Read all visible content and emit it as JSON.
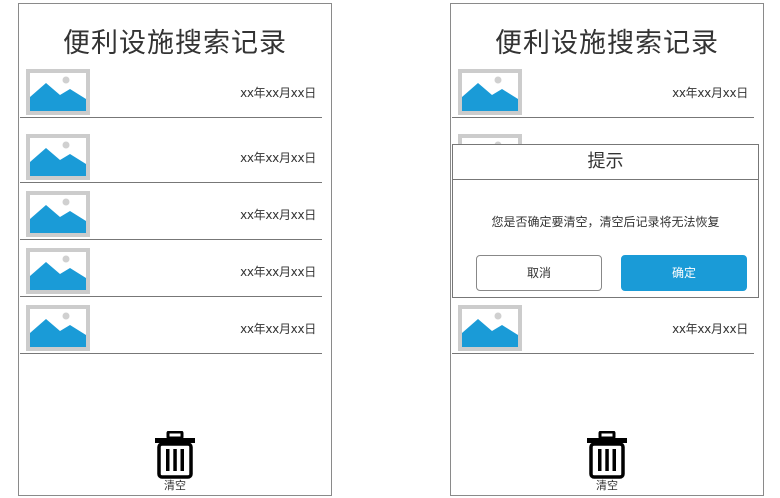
{
  "colors": {
    "accent": "#1a9bd7",
    "border": "#777777",
    "thumb_border": "#cccccc",
    "image_sky": "#d0d0d0"
  },
  "left_screen": {
    "title": "便利设施搜索记录",
    "records": [
      {
        "date": "xx年xx月xx日",
        "icon": "image-placeholder-icon"
      },
      {
        "date": "xx年xx月xx日",
        "icon": "image-placeholder-icon"
      },
      {
        "date": "xx年xx月xx日",
        "icon": "image-placeholder-icon"
      },
      {
        "date": "xx年xx月xx日",
        "icon": "image-placeholder-icon"
      },
      {
        "date": "xx年xx月xx日",
        "icon": "image-placeholder-icon"
      }
    ],
    "clear_label": "清空",
    "clear_icon": "trash-icon"
  },
  "right_screen": {
    "title": "便利设施搜索记录",
    "records": [
      {
        "date": "xx年xx月xx日",
        "icon": "image-placeholder-icon"
      },
      {
        "date": "xx年xx月xx日",
        "icon": "image-placeholder-icon"
      }
    ],
    "clear_label": "清空",
    "clear_icon": "trash-icon"
  },
  "dialog": {
    "title": "提示",
    "message": "您是否确定要清空，清空后记录将无法恢复",
    "cancel_label": "取消",
    "confirm_label": "确定"
  }
}
